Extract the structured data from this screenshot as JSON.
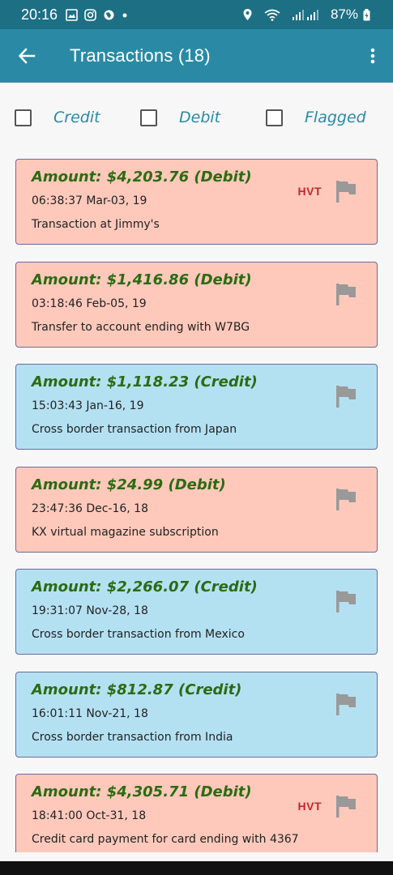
{
  "status_bar": {
    "time": "20:16",
    "battery": "87%"
  },
  "app_bar": {
    "title": "Transactions (18)"
  },
  "filters": [
    {
      "label": "Credit",
      "checked": false
    },
    {
      "label": "Debit",
      "checked": false
    },
    {
      "label": "Flagged",
      "checked": false
    }
  ],
  "colors": {
    "status_bar": "#1d6f84",
    "app_bar": "#2a8aa6",
    "debit_card": "#fec9bb",
    "credit_card": "#b4e1f2",
    "amount_text": "#2c6b12",
    "hvt_text": "#c2272c",
    "flag_icon": "#999999"
  },
  "transactions": [
    {
      "amount": "Amount: $4,203.76 (Debit)",
      "type": "debit",
      "time": "06:38:37 Mar-03, 19",
      "description": "Transaction at Jimmy's",
      "hvt": "HVT",
      "icon": "flag-icon"
    },
    {
      "amount": "Amount: $1,416.86 (Debit)",
      "type": "debit",
      "time": "03:18:46 Feb-05, 19",
      "description": "Transfer to account ending with W7BG",
      "icon": "flag-icon"
    },
    {
      "amount": "Amount: $1,118.23 (Credit)",
      "type": "credit",
      "time": "15:03:43 Jan-16, 19",
      "description": "Cross border transaction from Japan",
      "icon": "flag-icon"
    },
    {
      "amount": "Amount: $24.99 (Debit)",
      "type": "debit",
      "time": "23:47:36 Dec-16, 18",
      "description": "KX virtual magazine subscription",
      "icon": "flag-icon"
    },
    {
      "amount": "Amount: $2,266.07 (Credit)",
      "type": "credit",
      "time": "19:31:07 Nov-28, 18",
      "description": "Cross border transaction from Mexico",
      "icon": "flag-icon"
    },
    {
      "amount": "Amount: $812.87 (Credit)",
      "type": "credit",
      "time": "16:01:11 Nov-21, 18",
      "description": "Cross border transaction from India",
      "icon": "flag-icon"
    },
    {
      "amount": "Amount: $4,305.71 (Debit)",
      "type": "debit",
      "time": "18:41:00 Oct-31, 18",
      "description": "Credit card payment for card ending with 4367",
      "hvt": "HVT",
      "icon": "flag-icon"
    }
  ]
}
